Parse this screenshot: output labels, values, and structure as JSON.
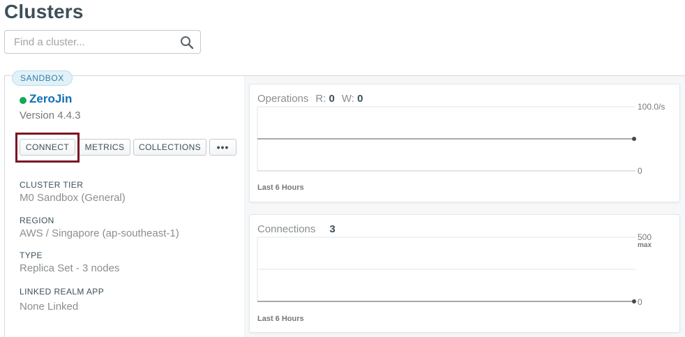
{
  "page": {
    "title": "Clusters"
  },
  "search": {
    "placeholder": "Find a cluster...",
    "value": "",
    "icon": "search-icon"
  },
  "cluster": {
    "tier_badge": "SANDBOX",
    "name": "ZeroJin",
    "status_color": "#13aa52",
    "version": "Version 4.4.3",
    "actions": {
      "connect": "CONNECT",
      "metrics": "METRICS",
      "collections": "COLLECTIONS",
      "more": "•••"
    },
    "details": {
      "tier_label": "CLUSTER TIER",
      "tier_value": "M0 Sandbox (General)",
      "region_label": "REGION",
      "region_value": "AWS / Singapore (ap-southeast-1)",
      "type_label": "TYPE",
      "type_value": "Replica Set - 3 nodes",
      "realm_label": "LINKED REALM APP",
      "realm_value": "None Linked"
    }
  },
  "operations": {
    "title": "Operations",
    "read_label": "R:",
    "read_value": "0",
    "write_label": "W:",
    "write_value": "0",
    "y_max_label": "100.0/s",
    "y_min_label": "0",
    "footer": "Last 6 Hours",
    "level_fraction": 0.5
  },
  "connections": {
    "title": "Connections",
    "value": "3",
    "y_max_label": "500",
    "y_max_sub": "max",
    "y_min_label": "0",
    "footer": "Last 6 Hours",
    "level_fraction": 0.0
  },
  "colors": {
    "highlight": "#7a1424",
    "link": "#0e6fb5",
    "badge_bg": "#e2f1f7",
    "badge_text": "#2f7ea7"
  }
}
